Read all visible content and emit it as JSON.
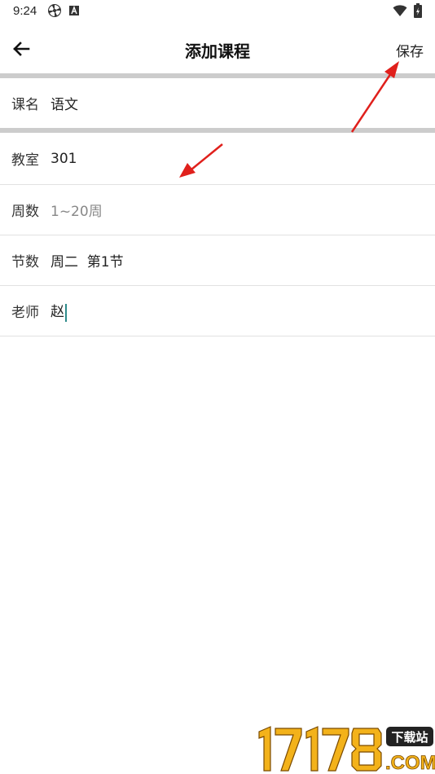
{
  "status_bar": {
    "time": "9:24",
    "icons": [
      "pinwheel-icon",
      "a-badge-icon",
      "wifi-icon",
      "battery-icon"
    ]
  },
  "app_bar": {
    "title": "添加课程",
    "save_label": "保存",
    "back_icon": "arrow-left-icon"
  },
  "form": {
    "course_name": {
      "label": "课名",
      "value": "语文"
    },
    "classroom": {
      "label": "教室",
      "value": "301"
    },
    "weeks": {
      "label": "周数",
      "placeholder": "1~20周"
    },
    "sessions": {
      "label": "节数",
      "value": "周二  第1节"
    },
    "teacher": {
      "label": "老师",
      "value": "赵"
    }
  },
  "annotations": {
    "arrow_color": "#e0201c"
  },
  "watermark": {
    "digits": "17178",
    "badge": "下载站",
    "suffix": ".COM"
  }
}
